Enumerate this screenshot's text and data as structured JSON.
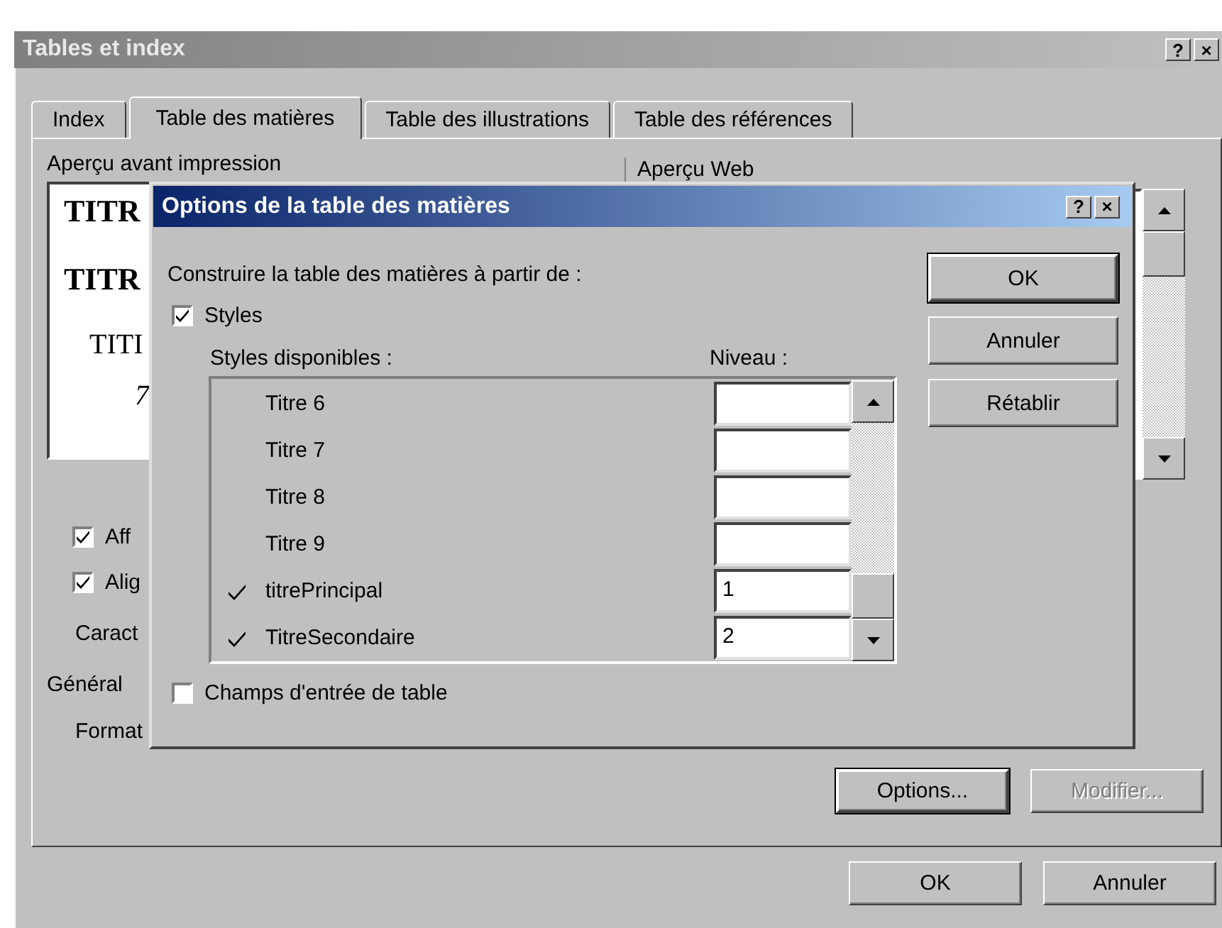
{
  "window": {
    "title": "Tables et index",
    "title_buttons": [
      "?",
      "×"
    ]
  },
  "tabs": [
    {
      "label": "Index",
      "selected": false
    },
    {
      "label": "Table des matières",
      "selected": true
    },
    {
      "label": "Table des illustrations",
      "selected": false
    },
    {
      "label": "Table des références",
      "selected": false
    }
  ],
  "print_preview": {
    "label": "Aperçu avant impression",
    "lines": [
      {
        "kind": "h1",
        "text": "TITR"
      },
      {
        "kind": "h1",
        "text": "TITR"
      },
      {
        "kind": "h2",
        "text": "TITI"
      },
      {
        "kind": "h3",
        "text": "7"
      }
    ]
  },
  "web_preview": {
    "label": "Aperçu Web"
  },
  "checkboxes": [
    {
      "label": "Aff",
      "checked": true
    },
    {
      "label": "Alig",
      "checked": true
    }
  ],
  "caract_label": "Caract",
  "general_label": "Général",
  "format_label": "Format",
  "panel_buttons": [
    {
      "label": "Options...",
      "default": true,
      "disabled": false
    },
    {
      "label": "Modifier...",
      "default": false,
      "disabled": true
    }
  ],
  "buttons": [
    {
      "label": "OK"
    },
    {
      "label": "Annuler"
    }
  ],
  "options_dialog": {
    "title": "Options de la table des matières",
    "title_buttons": [
      "?",
      "×"
    ],
    "intro": "Construire la table des matières à partir de :",
    "styles": {
      "label": "Styles",
      "checked": true
    },
    "available_label": "Styles disponibles :",
    "level_label": "Niveau :",
    "rows": [
      {
        "name": "Titre 6",
        "checked": false
      },
      {
        "name": "Titre 7",
        "checked": false
      },
      {
        "name": "Titre 8",
        "checked": false
      },
      {
        "name": "Titre 9",
        "checked": false
      },
      {
        "name": "titrePrincipal",
        "checked": true,
        "level_value": "1"
      },
      {
        "name": "TitreSecondaire",
        "checked": true,
        "level_value": "2"
      }
    ],
    "buttons": [
      {
        "label": "OK",
        "default": true
      },
      {
        "label": "Annuler",
        "default": false
      },
      {
        "label": "Rétablir",
        "default": false
      }
    ],
    "entry_fields": {
      "label": "Champs d'entrée de table",
      "checked": false
    }
  }
}
